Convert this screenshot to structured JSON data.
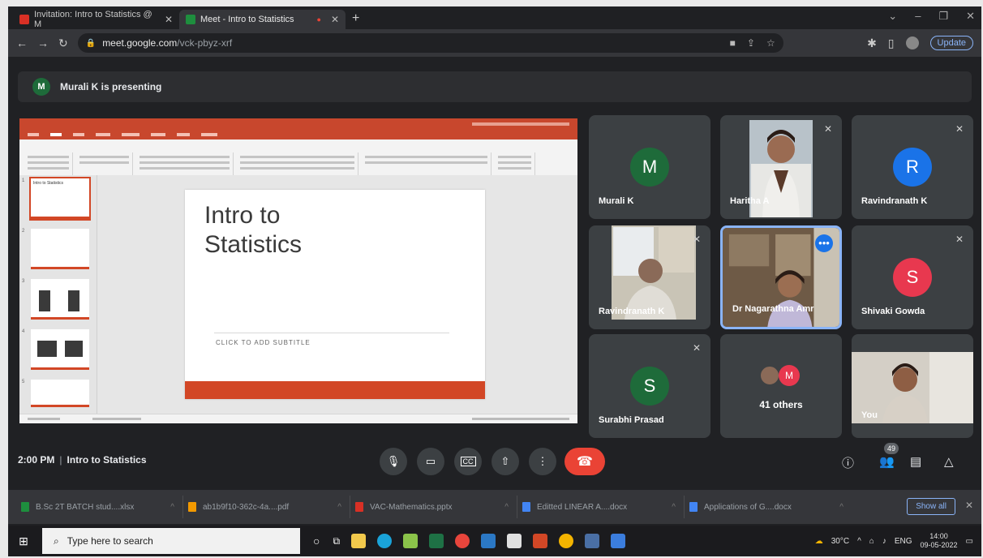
{
  "browser": {
    "tabs": [
      {
        "title": "Invitation: Intro to Statistics @ M",
        "favicon_color": "#d93025"
      },
      {
        "title": "Meet - Intro to Statistics",
        "favicon_color": "#1e8e3e"
      }
    ],
    "url_host": "meet.google.com",
    "url_path": "/vck-pbyz-xrf",
    "update_label": "Update"
  },
  "banner": {
    "avatar_letter": "M",
    "text": "Murali K is presenting"
  },
  "presentation": {
    "slide_title": "Intro to\nStatistics",
    "slide_subtitle": "CLICK TO ADD SUBTITLE",
    "thumb1_title": "Intro to Statistics",
    "accent": "#d24726"
  },
  "participants": [
    {
      "name": "Murali K",
      "letter": "M",
      "color": "#1e6b3a",
      "type": "avatar"
    },
    {
      "name": "Haritha A",
      "type": "video",
      "muted": true
    },
    {
      "name": "Ravindranath K",
      "letter": "R",
      "color": "#1a73e8",
      "type": "avatar",
      "muted": true
    },
    {
      "name": "Ravindranath K",
      "type": "video",
      "muted": true
    },
    {
      "name": "Dr Nagarathna Amr",
      "type": "video",
      "highlight": true
    },
    {
      "name": "Shivaki Gowda",
      "letter": "S",
      "color": "#e8384f",
      "type": "avatar",
      "muted": true
    },
    {
      "name": "Surabhi Prasad",
      "letter": "S",
      "color": "#1e6b3a",
      "type": "avatar",
      "muted": true
    },
    {
      "name": "41 others",
      "letter": "M",
      "type": "group"
    },
    {
      "name": "You",
      "type": "video"
    }
  ],
  "meeting": {
    "time": "2:00 PM",
    "title": "Intro to Statistics",
    "participant_count": "49"
  },
  "downloads": [
    {
      "name": "B.Sc 2T BATCH stud....xlsx",
      "color": "#1e8e3e"
    },
    {
      "name": "ab1b9f10-362c-4a....pdf",
      "color": "#f29900"
    },
    {
      "name": "VAC-Mathematics.pptx",
      "color": "#d93025"
    },
    {
      "name": "Editted LINEAR A....docx",
      "color": "#4285f4"
    },
    {
      "name": "Applications of G....docx",
      "color": "#4285f4"
    }
  ],
  "show_all_label": "Show all",
  "taskbar": {
    "search_placeholder": "Type here to search",
    "weather": "30°C",
    "lang": "ENG",
    "time": "14:00",
    "date": "09-05-2022"
  }
}
